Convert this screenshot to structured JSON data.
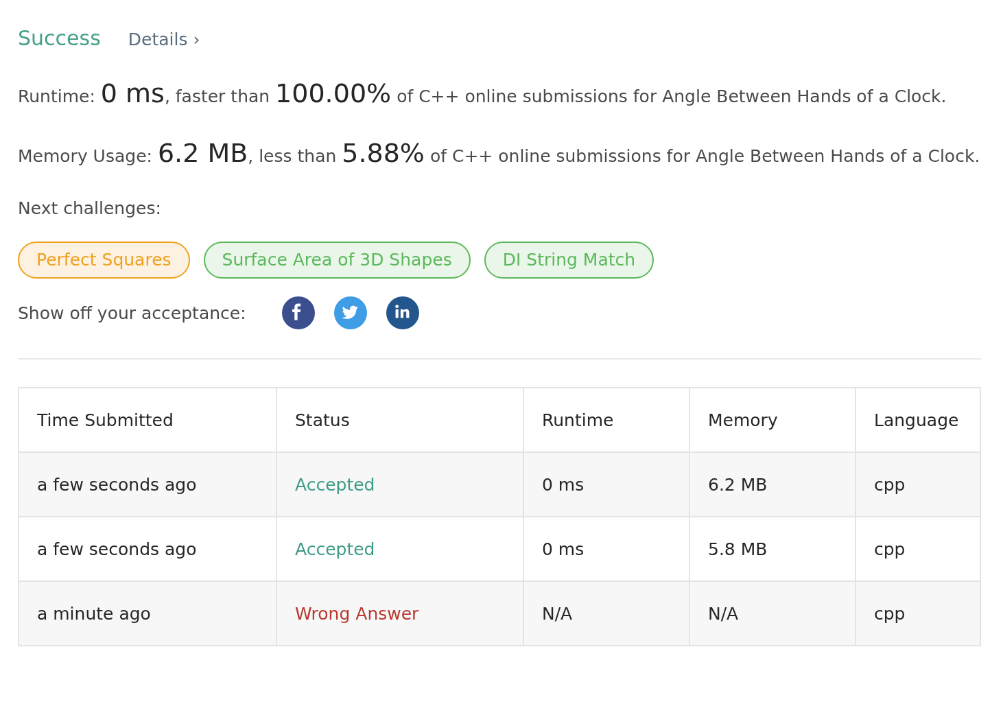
{
  "header": {
    "result": "Success",
    "details_link": "Details",
    "details_arrow": "›"
  },
  "stats": [
    {
      "label": "Runtime:",
      "value": "0 ms",
      "connector": ", faster than",
      "percent": "100.00%",
      "rest": "of C++ online submissions for Angle Between Hands of a Clock."
    },
    {
      "label": "Memory Usage:",
      "value": "6.2 MB",
      "connector": ", less than",
      "percent": "5.88%",
      "rest": "of C++ online submissions for Angle Between Hands of a Clock."
    }
  ],
  "next_challenges": {
    "label": "Next challenges:",
    "tags": [
      {
        "label": "Perfect Squares",
        "color": "#f0a020"
      },
      {
        "label": "Surface Area of 3D Shapes",
        "color": "#5cb85c"
      },
      {
        "label": "DI String Match",
        "color": "#5cb85c"
      }
    ]
  },
  "share": {
    "label": "Show off your acceptance:",
    "networks": [
      {
        "kind": "facebook"
      },
      {
        "kind": "twitter"
      },
      {
        "kind": "linkedin"
      }
    ]
  },
  "table": {
    "columns": [
      "Time Submitted",
      "Status",
      "Runtime",
      "Memory",
      "Language"
    ],
    "rows": [
      {
        "time": "a few seconds ago",
        "status": "Accepted",
        "color": "#3c9b86",
        "runtime": "0 ms",
        "memory": "6.2 MB",
        "language": "cpp"
      },
      {
        "time": "a few seconds ago",
        "status": "Accepted",
        "color": "#3c9b86",
        "runtime": "0 ms",
        "memory": "5.8 MB",
        "language": "cpp"
      },
      {
        "time": "a minute ago",
        "status": "Wrong Answer",
        "color": "#b9382f",
        "runtime": "N/A",
        "memory": "N/A",
        "language": "cpp"
      }
    ]
  }
}
